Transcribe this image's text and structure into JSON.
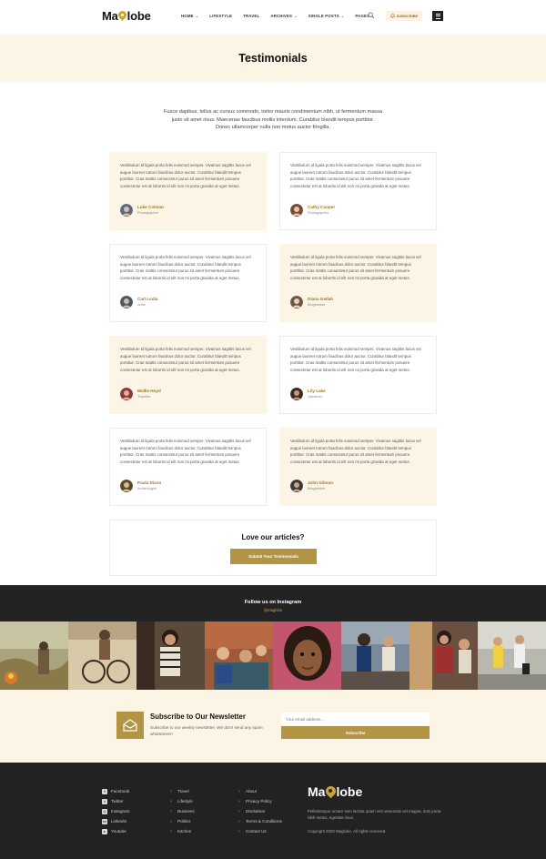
{
  "brand": {
    "name_left": "Ma",
    "name_right": "lobe",
    "accent_color": "#c9a338",
    "button_color": "#b39444",
    "tint_color": "#fcf5e6"
  },
  "nav": {
    "items": [
      {
        "label": "HOME",
        "dropdown": true
      },
      {
        "label": "LIFESTYLE",
        "dropdown": false
      },
      {
        "label": "TRAVEL",
        "dropdown": false
      },
      {
        "label": "ARCHIVES",
        "dropdown": true
      },
      {
        "label": "SINGLE POSTS",
        "dropdown": true
      },
      {
        "label": "PAGES",
        "dropdown": true
      }
    ],
    "subscribe_label": "SUBSCRIBE"
  },
  "page": {
    "title": "Testimonials",
    "intro": "Fusce dapibus, tellus ac cursus commodo, tortor mauris condimentum nibh, ut fermentum massa justo sit amet risus. Maecenas faucibus mollis interdum. Curabitur blandit tempus porttitor. Donec ullamcorper nulla non metus auctor fringilla."
  },
  "testimonials": [
    {
      "quote": "Vestibulum id ligula porta felis euismod semper. Vivamus sagittis lacus vel augue laoreet rutrum faucibus dolor auctor. Curabitur blandit tempus porttitor. Cras mattis consectetur purus sit amet fermentum posuere consectetur est at lobortis id elit non mi porta gravida at eget metus.",
      "name": "Luke Colman",
      "role": "Photographer"
    },
    {
      "quote": "Vestibulum id ligula porta felis euismod semper. Vivamus sagittis lacus vel augue laoreet rutrum faucibus dolor auctor. Curabitur blandit tempus porttitor. Cras mattis consectetur purus sit amet fermentum posuere consectetur est at lobortis id elit non mi porta gravida at eget metus.",
      "name": "Cathy Cooper",
      "role": "Photographer"
    },
    {
      "quote": "Vestibulum id ligula porta felis euismod semper. Vivamus sagittis lacus vel augue laoreet rutrum faucibus dolor auctor. Curabitur blandit tempus porttitor. Cras mattis consectetur purus sit amet fermentum posuere consectetur est at lobortis id elit non mi porta gravida at eget metus.",
      "name": "Carl Lodia",
      "role": "Artist"
    },
    {
      "quote": "Vestibulum id ligula porta felis euismod semper. Vivamus sagittis lacus vel augue laoreet rutrum faucibus dolor auctor. Curabitur blandit tempus porttitor. Cras mattis consectetur purus sit amet fermentum posuere consectetur est at lobortis id elit non mi porta gravida at eget metus.",
      "name": "Diana Gatlab",
      "role": "Blogbanker"
    },
    {
      "quote": "Vestibulum id ligula porta felis euismod semper. Vivamus sagittis lacus vel augue laoreet rutrum faucibus dolor auctor. Curabitur blandit tempus porttitor. Cras mattis consectetur purus sit amet fermentum posuere consectetur est at lobortis id elit non mi porta gravida at eget metus.",
      "name": "Mollie Hoyd",
      "role": "Traveller"
    },
    {
      "quote": "Vestibulum id ligula porta felis euismod semper. Vivamus sagittis lacus vel augue laoreet rutrum faucibus dolor auctor. Curabitur blandit tempus porttitor. Cras mattis consectetur purus sit amet fermentum posuere consectetur est at lobortis id elit non mi porta gravida at eget metus.",
      "name": "Lily Lake",
      "role": "Gardener"
    },
    {
      "quote": "Vestibulum id ligula porta felis euismod semper. Vivamus sagittis lacus vel augue laoreet rutrum faucibus dolor auctor. Curabitur blandit tempus porttitor. Cras mattis consectetur purus sit amet fermentum posuere consectetur est at lobortis id elit non mi porta gravida at eget metus.",
      "name": "Paula Dixon",
      "role": "Archeologist"
    },
    {
      "quote": "Vestibulum id ligula porta felis euismod semper. Vivamus sagittis lacus vel augue laoreet rutrum faucibus dolor auctor. Curabitur blandit tempus porttitor. Cras mattis consectetur purus sit amet fermentum posuere consectetur est at lobortis id elit non mi porta gravida at eget metus.",
      "name": "John Gibson",
      "role": "Blogbanker"
    }
  ],
  "love": {
    "title": "Love our articles?",
    "button_label": "Submit Your Testimonials"
  },
  "instagram": {
    "title": "Follow us on Instagram",
    "handle": "@maglobe"
  },
  "newsletter": {
    "title": "Subscribe to Our Newsletter",
    "desc": "Subscribe to our weekly newsletter. We don't send any spam whatsoever!",
    "placeholder": "Your email address...",
    "button_label": "Subscribe"
  },
  "footer": {
    "social": [
      {
        "label": "Facebook",
        "icon": "facebook-icon",
        "glyph": "f"
      },
      {
        "label": "Twitter",
        "icon": "twitter-icon",
        "glyph": "t"
      },
      {
        "label": "Instagram",
        "icon": "instagram-icon",
        "glyph": "◎"
      },
      {
        "label": "LinkedIn",
        "icon": "linkedin-icon",
        "glyph": "in"
      },
      {
        "label": "Youtube",
        "icon": "youtube-icon",
        "glyph": "▸"
      }
    ],
    "col2": [
      "Travel",
      "Lifestyle",
      "Business",
      "Politics",
      "Kitchen"
    ],
    "col3": [
      "About",
      "Privacy Policy",
      "Disclaimer",
      "Terms & Conditions",
      "Contact Us"
    ],
    "desc": "Pellentesque ornare sem lacinia quam ven venenatis vel magna, dolo porta nibh metus, egestas risus.",
    "copyright": "Copyright 2020 Maglobe. All rights reserved."
  }
}
